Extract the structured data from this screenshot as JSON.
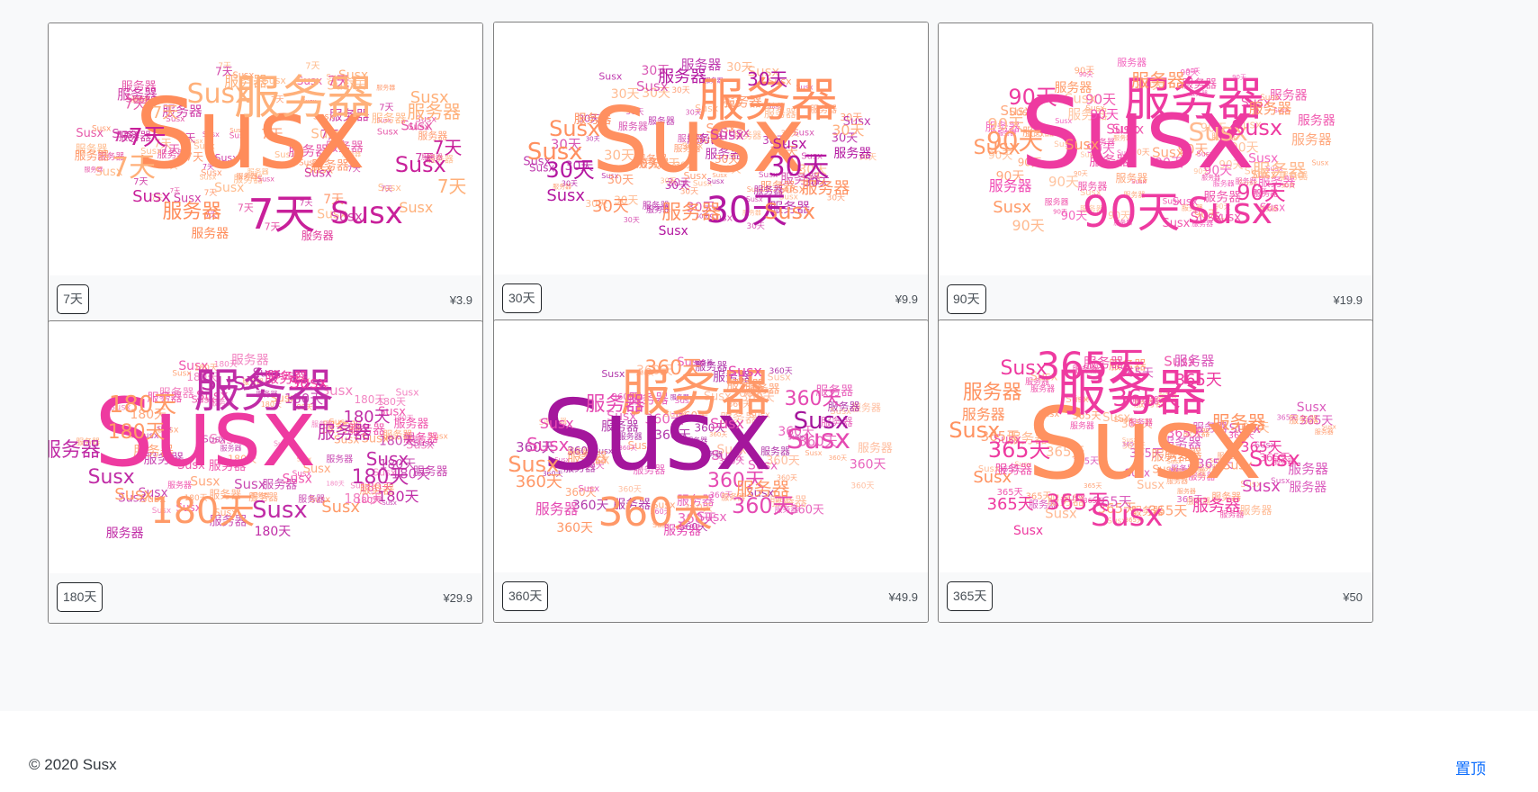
{
  "plans": [
    {
      "duration": "7天",
      "price": "¥3.9",
      "cloud": {
        "brand": "Susx",
        "server": "服务器",
        "palette": [
          "#ff8c5a",
          "#c8209a",
          "#ffb07a",
          "#e23c9b"
        ]
      }
    },
    {
      "duration": "30天",
      "price": "¥9.9",
      "cloud": {
        "brand": "Susx",
        "server": "服务器",
        "palette": [
          "#b317a0",
          "#ff9060",
          "#d23ca8",
          "#ffb080"
        ]
      }
    },
    {
      "duration": "90天",
      "price": "¥19.9",
      "cloud": {
        "brand": "Susx",
        "server": "服务器",
        "palette": [
          "#ee3aa0",
          "#ff9a68",
          "#f14bb4",
          "#ffba90"
        ]
      }
    },
    {
      "duration": "180天",
      "price": "¥29.9",
      "cloud": {
        "brand": "Susx",
        "server": "服务器",
        "palette": [
          "#ee3aa0",
          "#c02ca6",
          "#ff9a68",
          "#f070b8"
        ]
      }
    },
    {
      "duration": "360天",
      "price": "¥49.9",
      "cloud": {
        "brand": "Susx",
        "server": "服务器",
        "palette": [
          "#a4169c",
          "#ff9868",
          "#e54ab2",
          "#ffb390"
        ]
      }
    },
    {
      "duration": "365天",
      "price": "¥50",
      "cloud": {
        "brand": "Susx",
        "server": "服务器",
        "palette": [
          "#ff9260",
          "#ee3aa0",
          "#ffae82",
          "#d541b2"
        ]
      }
    }
  ],
  "footer": {
    "copyright": "© 2020 Susx",
    "back_to_top": "置顶"
  }
}
